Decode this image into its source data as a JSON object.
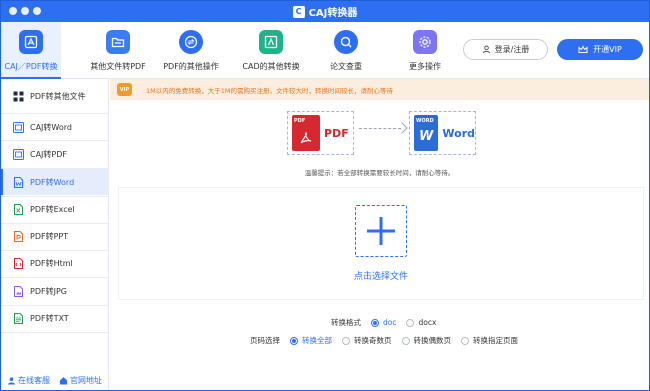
{
  "app": {
    "title": "CAJ转换器",
    "logo_glyph": "C"
  },
  "toolbar": {
    "tools": [
      {
        "label": "CAJ／PDF转换",
        "icon": "caj-pdf-convert-icon",
        "color": "#2d6ff0",
        "active": true
      },
      {
        "label": "其他文件转PDF",
        "icon": "folder-icon",
        "color": "#3d7bf2",
        "active": false
      },
      {
        "label": "PDF的其他操作",
        "icon": "swap-icon",
        "color": "#2d6ff0",
        "active": false
      },
      {
        "label": "CAD的其他转换",
        "icon": "cad-icon",
        "color": "#20b28b",
        "active": false
      },
      {
        "label": "论文查重",
        "icon": "search-check-icon",
        "color": "#2d6ff0",
        "active": false
      },
      {
        "label": "更多操作",
        "icon": "gear-icon",
        "color": "#7c74f0",
        "active": false
      }
    ],
    "login_label": "登录/注册",
    "vip_label": "开通VIP"
  },
  "sidebar": {
    "header": "PDF转其他文件",
    "items": [
      {
        "label": "CAJ转Word",
        "active": false
      },
      {
        "label": "CAJ转PDF",
        "active": false
      },
      {
        "label": "PDF转Word",
        "active": true
      },
      {
        "label": "PDF转Excel",
        "active": false
      },
      {
        "label": "PDF转PPT",
        "active": false
      },
      {
        "label": "PDF转Html",
        "active": false
      },
      {
        "label": "PDF转JPG",
        "active": false
      },
      {
        "label": "PDF转TXT",
        "active": false
      }
    ],
    "footer": {
      "service_label": "在线客服",
      "website_label": "官网地址"
    }
  },
  "notice": {
    "icon_glyph": "VIP",
    "text": "1M以内的免费转换，大于1M的需购买注册，文件较大时，转换时间较长，请耐心等待"
  },
  "conversion": {
    "from_label": "PDF",
    "from_tag": "PDF",
    "to_label": "Word",
    "to_tag": "WORD",
    "to_glyph": "W"
  },
  "tip": "温馨提示：若全部转换需要较长时间，请耐心等待。",
  "dropzone": {
    "label": "点击选择文件"
  },
  "options": {
    "format_label": "转换格式",
    "formats": [
      {
        "label": "doc",
        "selected": true
      },
      {
        "label": "docx",
        "selected": false
      }
    ],
    "page_label": "页码选择",
    "pages": [
      {
        "label": "转换全部",
        "selected": true
      },
      {
        "label": "转换奇数页",
        "selected": false
      },
      {
        "label": "转换偶数页",
        "selected": false
      },
      {
        "label": "转换指定页面",
        "selected": false
      }
    ]
  }
}
